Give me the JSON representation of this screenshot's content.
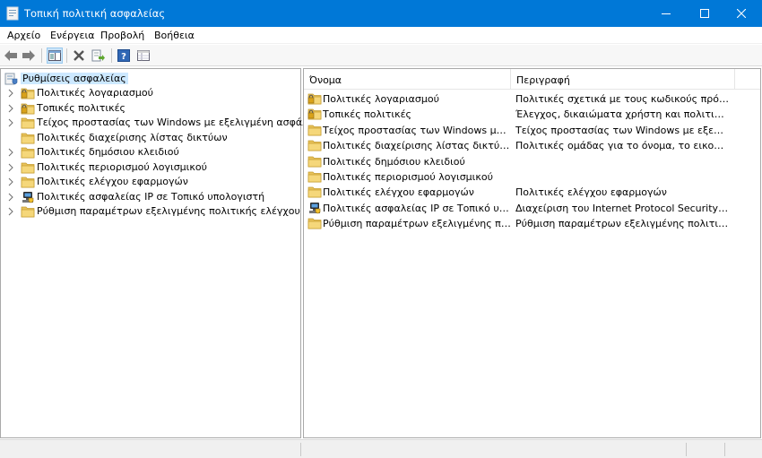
{
  "window": {
    "title": "Τοπική πολιτική ασφαλείας"
  },
  "menu": [
    "Αρχείο",
    "Ενέργεια",
    "Προβολή",
    "Βοήθεια"
  ],
  "toolbar_icons": [
    "back-arrow-icon",
    "forward-arrow-icon",
    "console-tree-icon",
    "delete-icon",
    "export-list-icon",
    "help-icon",
    "properties-icon"
  ],
  "tree": {
    "root": "Ρυθμίσεις ασφαλείας",
    "items": [
      {
        "label": "Πολιτικές λογαριασμού",
        "icon": "folder-lock-icon",
        "expandable": true
      },
      {
        "label": "Τοπικές πολιτικές",
        "icon": "folder-lock-icon",
        "expandable": true
      },
      {
        "label": "Τείχος προστασίας των Windows με εξελιγμένη ασφάλεια",
        "icon": "folder-icon",
        "expandable": true
      },
      {
        "label": "Πολιτικές διαχείρισης λίστας δικτύων",
        "icon": "folder-icon",
        "expandable": false
      },
      {
        "label": "Πολιτικές δημόσιου κλειδιού",
        "icon": "folder-icon",
        "expandable": true
      },
      {
        "label": "Πολιτικές περιορισμού λογισμικού",
        "icon": "folder-icon",
        "expandable": true
      },
      {
        "label": "Πολιτικές ελέγχου εφαρμογών",
        "icon": "folder-icon",
        "expandable": true
      },
      {
        "label": "Πολιτικές ασφαλείας IP σε Τοπικό υπολογιστή",
        "icon": "ip-security-icon",
        "expandable": true
      },
      {
        "label": "Ρύθμιση παραμέτρων εξελιγμένης πολιτικής ελέγχου",
        "icon": "folder-icon",
        "expandable": true
      }
    ]
  },
  "list": {
    "columns": [
      "Όνομα",
      "Περιγραφή"
    ],
    "rows": [
      {
        "name": "Πολιτικές λογαριασμού",
        "desc": "Πολιτικές σχετικά με τους κωδικούς πρόσβασης και το κλείδωμα λογαριασμού",
        "icon": "folder-lock-icon"
      },
      {
        "name": "Τοπικές πολιτικές",
        "desc": "Έλεγχος, δικαιώματα χρήστη και πολιτικές επιλογών ασφαλείας",
        "icon": "folder-lock-icon"
      },
      {
        "name": "Τείχος προστασίας των Windows με εξελιγμένη ασφάλεια",
        "desc": "Τείχος προστασίας των Windows με εξελιγμένη ασφάλεια",
        "icon": "folder-icon"
      },
      {
        "name": "Πολιτικές διαχείρισης λίστας δικτύων",
        "desc": "Πολιτικές ομάδας για το όνομα, το εικονίδιο και τη θέση δικτύου",
        "icon": "folder-icon"
      },
      {
        "name": "Πολιτικές δημόσιου κλειδιού",
        "desc": "",
        "icon": "folder-icon"
      },
      {
        "name": "Πολιτικές περιορισμού λογισμικού",
        "desc": "",
        "icon": "folder-icon"
      },
      {
        "name": "Πολιτικές ελέγχου εφαρμογών",
        "desc": "Πολιτικές ελέγχου εφαρμογών",
        "icon": "folder-icon"
      },
      {
        "name": "Πολιτικές ασφαλείας IP σε Τοπικό υπολογιστή",
        "desc": "Διαχείριση του Internet Protocol Security (IPsec)",
        "icon": "ip-security-icon"
      },
      {
        "name": "Ρύθμιση παραμέτρων εξελιγμένης πολιτικής ελέγχου",
        "desc": "Ρύθμιση παραμέτρων εξελιγμένης πολιτικής ελέγχου",
        "icon": "folder-icon"
      }
    ]
  },
  "colors": {
    "titlebar": "#0078d7",
    "selection": "#cce8ff",
    "folder": "#e8c25a"
  }
}
